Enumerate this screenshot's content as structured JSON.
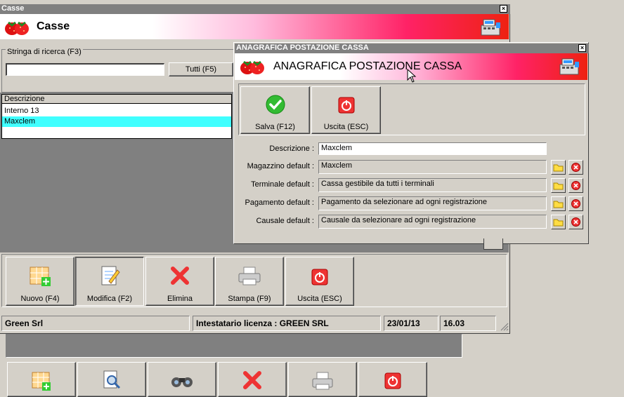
{
  "casse_window": {
    "title": "Casse",
    "banner_title": "Casse",
    "search_label": "Stringa di ricerca (F3)",
    "search_value": "",
    "all_button": "Tutti (F5)",
    "list_header": "Descrizione",
    "list_items": [
      "Interno 13",
      "Maxclem"
    ],
    "selected_index": 1,
    "toolbar": {
      "new": "Nuovo (F4)",
      "edit": "Modifica (F2)",
      "delete": "Elimina",
      "print": "Stampa (F9)",
      "exit": "Uscita (ESC)"
    },
    "status": {
      "company": "Green Srl",
      "license": "Intestatario licenza : GREEN SRL",
      "date": "23/01/13",
      "time": "16.03"
    }
  },
  "dialog": {
    "title": "ANAGRAFICA POSTAZIONE CASSA",
    "banner_title": "ANAGRAFICA POSTAZIONE CASSA",
    "save_button": "Salva (F12)",
    "exit_button": "Uscita (ESC)",
    "fields": {
      "descrizione_label": "Descrizione :",
      "descrizione_value": "Maxclem",
      "magazzino_label": "Magazzino default :",
      "magazzino_value": "Maxclem",
      "terminale_label": "Terminale default :",
      "terminale_value": "Cassa gestibile da tutti i terminali",
      "pagamento_label": "Pagamento default :",
      "pagamento_value": "Pagamento da selezionare ad ogni registrazione",
      "causale_label": "Causale default :",
      "causale_value": "Causale da selezionare ad ogni registrazione"
    }
  },
  "colors": {
    "selection": "#40ffff",
    "banner_red": "#e21",
    "window_bg": "#d4d0c8",
    "dark_area": "#808080"
  }
}
